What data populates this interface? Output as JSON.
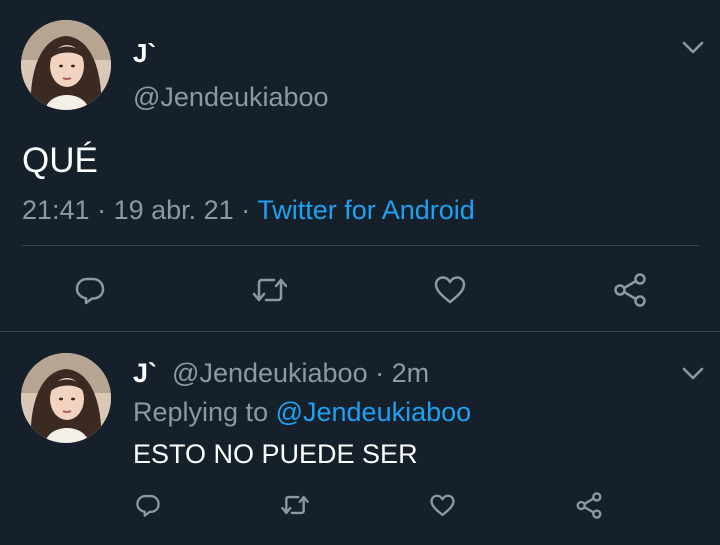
{
  "main_tweet": {
    "display_name": "J`",
    "handle": "@Jendeukiaboo",
    "text": "QUÉ",
    "time": "21:41",
    "separator_1": " · ",
    "date": "19 abr. 21",
    "separator_2": " · ",
    "source": "Twitter for Android",
    "menu_icon": "chevron-down-icon",
    "actions": [
      "reply-icon",
      "retweet-icon",
      "like-icon",
      "share-icon"
    ]
  },
  "reply_tweet": {
    "display_name": "J`",
    "handle": "@Jendeukiaboo",
    "separator": " · ",
    "age": "2m",
    "replying_label": "Replying to ",
    "replying_to": "@Jendeukiaboo",
    "text": "ESTO NO PUEDE SER",
    "menu_icon": "chevron-down-icon",
    "actions": [
      "reply-icon",
      "retweet-icon",
      "like-icon",
      "share-icon"
    ]
  },
  "colors": {
    "background": "#15202b",
    "text_primary": "#ffffff",
    "text_secondary": "#8b98a5",
    "accent": "#1da1f2",
    "divider": "#38444d"
  }
}
